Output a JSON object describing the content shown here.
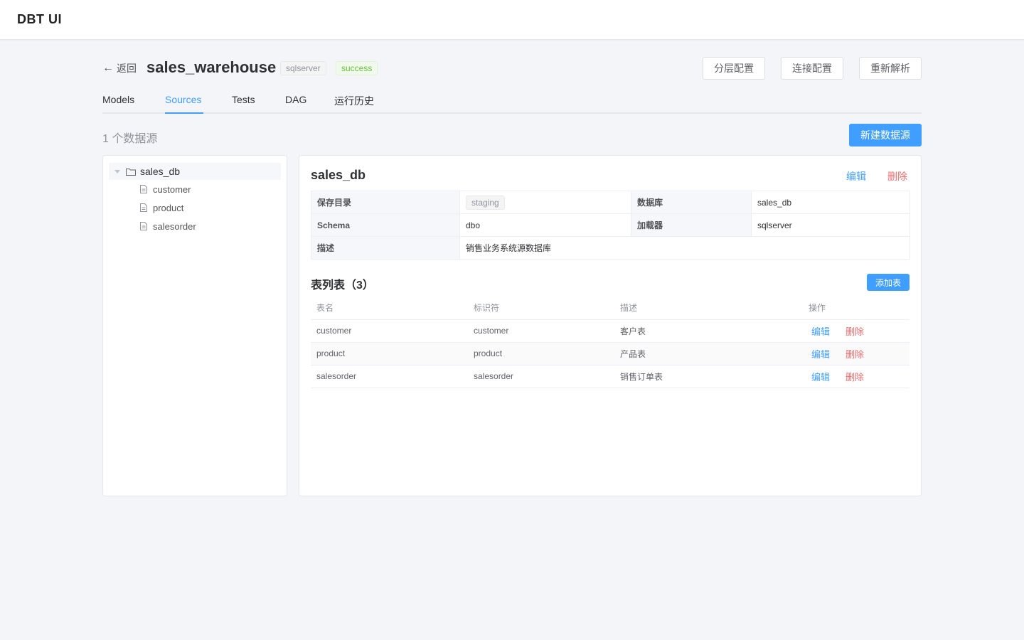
{
  "app": {
    "title": "DBT UI"
  },
  "project": {
    "back_label": "返回",
    "name": "sales_warehouse",
    "adapter_tag": "sqlserver",
    "status_tag": "success",
    "buttons": {
      "layer_config": "分层配置",
      "connection_config": "连接配置",
      "reparse": "重新解析"
    }
  },
  "tabs": [
    {
      "label": "Models",
      "active": false
    },
    {
      "label": "Sources",
      "active": true
    },
    {
      "label": "Tests",
      "active": false
    },
    {
      "label": "DAG",
      "active": false
    },
    {
      "label": "运行历史",
      "active": false
    }
  ],
  "sources": {
    "count_label": "1 个数据源",
    "new_button": "新建数据源",
    "tree": {
      "root": "sales_db",
      "children": [
        "customer",
        "product",
        "salesorder"
      ]
    }
  },
  "detail": {
    "title": "sales_db",
    "edit": "编辑",
    "delete": "删除",
    "fields": {
      "save_dir_label": "保存目录",
      "save_dir_value": "staging",
      "database_label": "数据库",
      "database_value": "sales_db",
      "schema_label": "Schema",
      "schema_value": "dbo",
      "loader_label": "加载器",
      "loader_value": "sqlserver",
      "description_label": "描述",
      "description_value": "销售业务系统源数据库"
    },
    "tables_heading": "表列表（3）",
    "add_table": "添加表",
    "table": {
      "columns": [
        "表名",
        "标识符",
        "描述",
        "操作"
      ],
      "rows": [
        {
          "name": "customer",
          "identifier": "customer",
          "description": "客户表",
          "edit": "编辑",
          "delete": "删除"
        },
        {
          "name": "product",
          "identifier": "product",
          "description": "产品表",
          "edit": "编辑",
          "delete": "删除"
        },
        {
          "name": "salesorder",
          "identifier": "salesorder",
          "description": "销售订单表",
          "edit": "编辑",
          "delete": "删除"
        }
      ]
    }
  },
  "colors": {
    "primary": "#409eff",
    "danger": "#f56c6c",
    "success": "#67c23a",
    "background": "#f3f5f9"
  }
}
